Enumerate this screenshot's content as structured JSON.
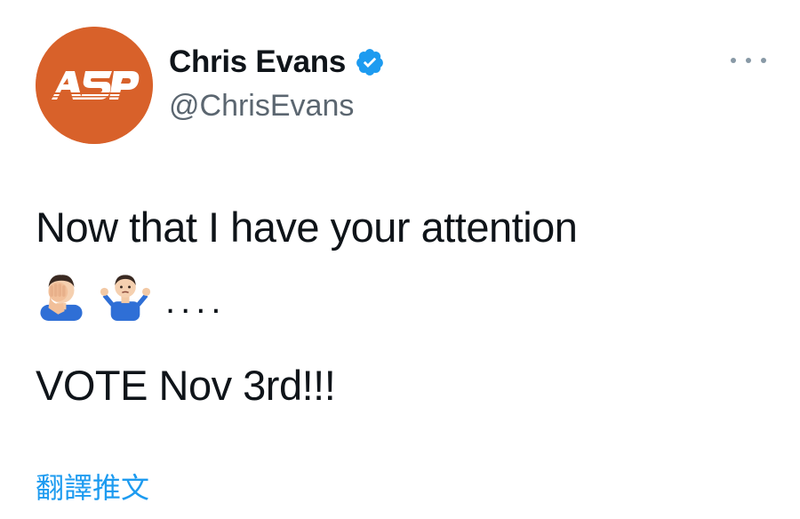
{
  "author": {
    "display_name": "Chris Evans",
    "handle": "@ChrisEvans",
    "verified": true,
    "avatar_text": "ASP",
    "avatar_color": "#d8612a"
  },
  "tweet": {
    "line1": "Now that I have your attention",
    "emojis": [
      "face-palm-emoji",
      "shrug-emoji"
    ],
    "ellipsis": "....",
    "line3": "VOTE Nov 3rd!!!"
  },
  "actions": {
    "more_icon": "more-icon",
    "translate_label": "翻譯推文"
  },
  "colors": {
    "text": "#0f1419",
    "secondary": "#5b6670",
    "link": "#1d9bf0",
    "verified": "#1d9bf0"
  }
}
